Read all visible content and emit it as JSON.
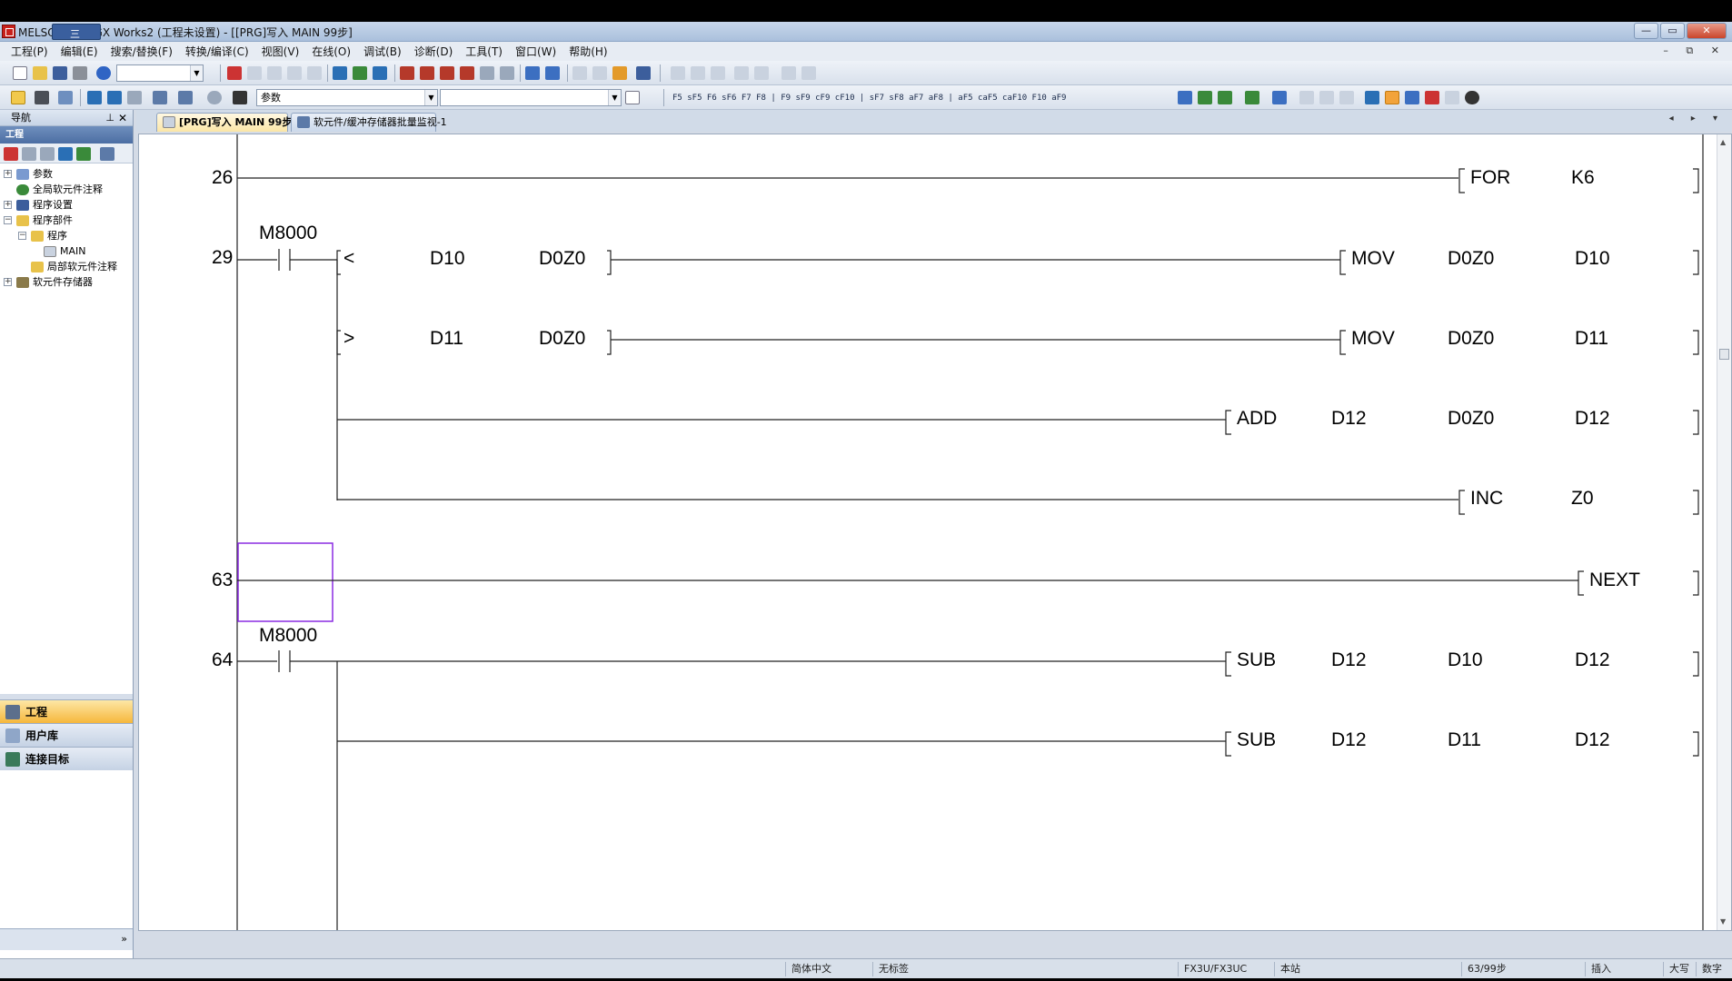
{
  "window": {
    "title": "MELSOFT系列 GX Works2 (工程未设置) - [[PRG]写入 MAIN 99步]",
    "quick_access_label": "三",
    "controls": {
      "minimize": "—",
      "restore": "▭",
      "close": "✕"
    }
  },
  "menu": {
    "items": [
      "工程(P)",
      "编辑(E)",
      "搜索/替换(F)",
      "转换/编译(C)",
      "视图(V)",
      "在线(O)",
      "调试(B)",
      "诊断(D)",
      "工具(T)",
      "窗口(W)",
      "帮助(H)"
    ],
    "mdi_controls": "– ⧉ ✕"
  },
  "toolbar": {
    "combo1": "",
    "combo2": "参数",
    "ladder_symbols": "F5 sF5 F6 sF6 F7 F8 | F9 sF9 cF9 cF10 | sF7 sF8 aF7 aF8 | aF5 caF5 caF10 F10 aF9"
  },
  "navigation": {
    "header": "导航",
    "pin_icon": "pin-icon",
    "subheader": "工程",
    "tree": [
      {
        "label": "参数",
        "expander": "+"
      },
      {
        "label": "全局软元件注释",
        "expander": ""
      },
      {
        "label": "程序设置",
        "expander": "+"
      },
      {
        "label": "程序部件",
        "expander": "−"
      },
      {
        "label": "程序",
        "expander": "−"
      },
      {
        "label": "MAIN",
        "expander": ""
      },
      {
        "label": "局部软元件注释",
        "expander": ""
      },
      {
        "label": "软元件存储器",
        "expander": "+"
      }
    ],
    "bottom_buttons": [
      "工程",
      "用户库",
      "连接目标"
    ],
    "footer_chevron": "»"
  },
  "tabs": [
    {
      "label": "[PRG]写入 MAIN 99步",
      "active": true,
      "close": "×"
    },
    {
      "label": "软元件/缓冲存储器批量监视-1",
      "active": false
    }
  ],
  "ladder": {
    "rungs": [
      {
        "step": "26",
        "instructions": [
          {
            "op": "FOR",
            "args": [
              "K6"
            ]
          }
        ]
      },
      {
        "step": "29",
        "contact": "M8000",
        "compare": [
          {
            "op": "<",
            "args": [
              "D10",
              "D0Z0"
            ]
          },
          {
            "op": ">",
            "args": [
              "D11",
              "D0Z0"
            ]
          }
        ],
        "instructions": [
          {
            "op": "MOV",
            "args": [
              "D0Z0",
              "D10"
            ]
          },
          {
            "op": "MOV",
            "args": [
              "D0Z0",
              "D11"
            ]
          },
          {
            "op": "ADD",
            "args": [
              "D12",
              "D0Z0",
              "D12"
            ]
          },
          {
            "op": "INC",
            "args": [
              "Z0"
            ]
          }
        ]
      },
      {
        "step": "63",
        "instructions": [
          {
            "op": "NEXT",
            "args": []
          }
        ]
      },
      {
        "step": "64",
        "contact": "M8000",
        "instructions": [
          {
            "op": "SUB",
            "args": [
              "D12",
              "D10",
              "D12"
            ]
          },
          {
            "op": "SUB",
            "args": [
              "D12",
              "D11",
              "D12"
            ]
          }
        ]
      }
    ]
  },
  "status_bar": {
    "language": "简体中文",
    "label": "无标签",
    "cpu": "FX3U/FX3UC",
    "station": "本站",
    "steps": "63/99步",
    "mode": "插入",
    "caps": "大写",
    "num": "数字"
  },
  "colors": {
    "cursor": "#8a2be2",
    "active_tab": "#fbe6a6",
    "active_nav": "#f6b73c"
  }
}
